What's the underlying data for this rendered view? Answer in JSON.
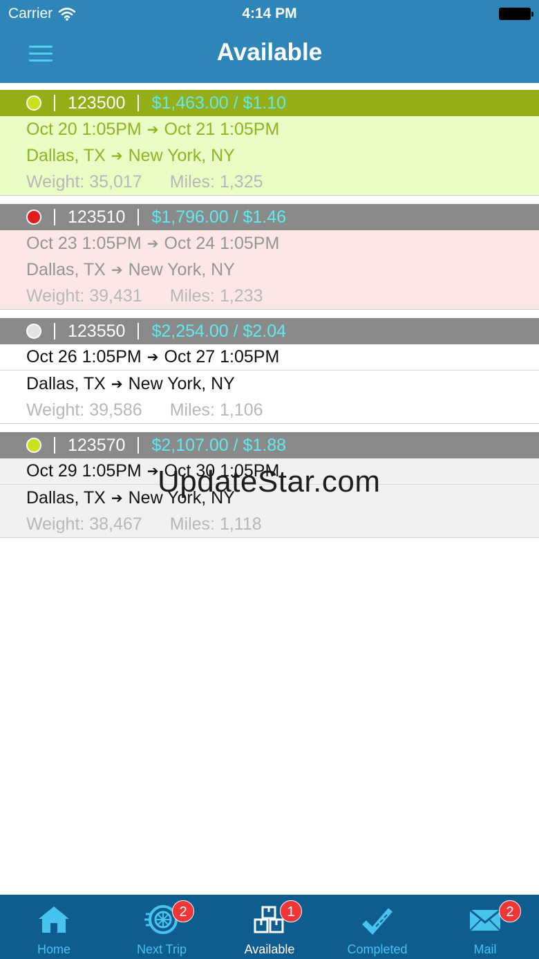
{
  "status_bar": {
    "carrier": "Carrier",
    "time": "4:14 PM"
  },
  "nav": {
    "title": "Available"
  },
  "loads": [
    {
      "id": "123500",
      "price": "$1,463.00 / $1.10",
      "status_color": "#c8e31c",
      "header_color": "#94ae17",
      "body_color": "#e9fdc4",
      "text_color": "#8db522",
      "pickup": "Oct 20 1:05PM",
      "delivery": "Oct 21 1:05PM",
      "origin": "Dallas, TX",
      "destination": "New York, NY",
      "weight": "Weight: 35,017",
      "miles": "Miles: 1,325"
    },
    {
      "id": "123510",
      "price": "$1,796.00 / $1.46",
      "status_color": "#e31b1b",
      "header_color": "#8a8a8a",
      "body_color": "#fde6e6",
      "text_color": "#959595",
      "pickup": "Oct 23 1:05PM",
      "delivery": "Oct 24 1:05PM",
      "origin": "Dallas, TX",
      "destination": "New York, NY",
      "weight": "Weight: 39,431",
      "miles": "Miles: 1,233"
    },
    {
      "id": "123550",
      "price": "$2,254.00 / $2.04",
      "status_color": "#e4e4e4",
      "header_color": "#8a8a8a",
      "body_color": "#ffffff",
      "text_color": "#111111",
      "pickup": "Oct 26 1:05PM",
      "delivery": "Oct 27 1:05PM",
      "origin": "Dallas, TX",
      "destination": "New York, NY",
      "weight": "Weight: 39,586",
      "miles": "Miles: 1,106"
    },
    {
      "id": "123570",
      "price": "$2,107.00 / $1.88",
      "status_color": "#c8e31c",
      "header_color": "#8a8a8a",
      "body_color": "#f1f1f1",
      "text_color": "#111111",
      "pickup": "Oct 29 1:05PM",
      "delivery": "Oct 30 1:05PM",
      "origin": "Dallas, TX",
      "destination": "New York, NY",
      "weight": "Weight: 38,467",
      "miles": "Miles: 1,118"
    }
  ],
  "watermark": "UpdateStar.com",
  "tabs": [
    {
      "label": "Home",
      "icon": "home-icon",
      "badge": "",
      "active": false
    },
    {
      "label": "Next Trip",
      "icon": "tire-icon",
      "badge": "2",
      "active": false
    },
    {
      "label": "Available",
      "icon": "boxes-icon",
      "badge": "1",
      "active": true
    },
    {
      "label": "Completed",
      "icon": "check-ruler-icon",
      "badge": "",
      "active": false
    },
    {
      "label": "Mail",
      "icon": "mail-icon",
      "badge": "2",
      "active": false
    }
  ]
}
